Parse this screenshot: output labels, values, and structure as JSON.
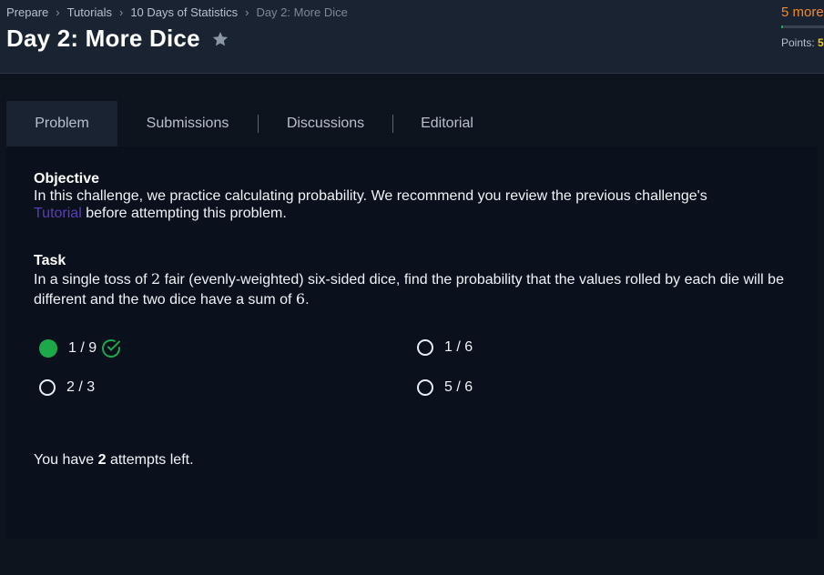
{
  "breadcrumb": {
    "items": [
      "Prepare",
      "Tutorials",
      "10 Days of Statistics"
    ],
    "current": "Day 2: More Dice"
  },
  "header": {
    "title": "Day 2: More Dice",
    "more_text": "5 more",
    "points_label": "Points:",
    "points_value": "5",
    "progress_fraction": 0.04
  },
  "tabs": [
    "Problem",
    "Submissions",
    "Discussions",
    "Editorial"
  ],
  "problem": {
    "objective_heading": "Objective",
    "objective_text_1": "In this challenge, we practice calculating probability. We recommend you review the previous challenge's",
    "objective_link": "Tutorial",
    "objective_text_2": " before attempting this problem.",
    "task_heading": "Task",
    "task_text_1": "In a single toss of ",
    "task_num_1": "2",
    "task_text_2": " fair (evenly-weighted) six-sided dice, find the probability that the values rolled by each die will be different and the two dice have a sum of ",
    "task_num_2": "6",
    "task_text_3": "."
  },
  "options": [
    {
      "label": "1 / 9",
      "selected": true,
      "correct": true
    },
    {
      "label": "1 / 6",
      "selected": false
    },
    {
      "label": "2 / 3",
      "selected": false
    },
    {
      "label": "5 / 6",
      "selected": false
    }
  ],
  "attempts": {
    "prefix": "You have ",
    "count": "2",
    "suffix": " attempts left."
  },
  "colors": {
    "background": "#0e141e",
    "header": "#1a2332",
    "accent_green": "#1ba94c",
    "link_purple": "#5b3eb6",
    "orange": "#f28a2a"
  },
  "icons": [
    "star-icon",
    "chevron-right-icon",
    "check-circle-icon"
  ]
}
